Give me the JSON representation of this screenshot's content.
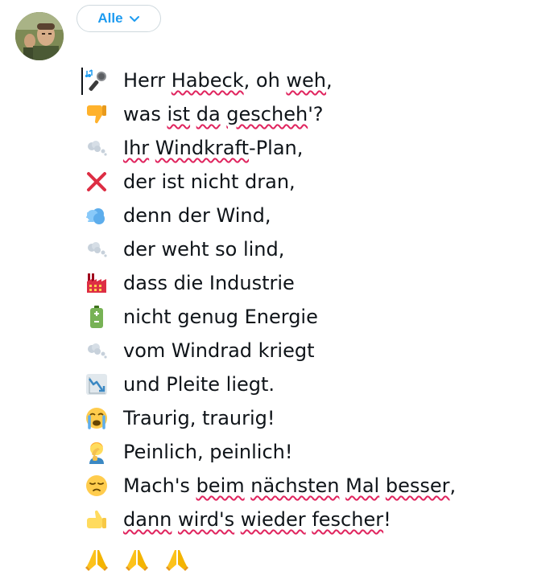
{
  "header": {
    "audience_label": "Alle"
  },
  "poem": {
    "lines": [
      {
        "icon": "microphone-icon",
        "segments": [
          {
            "t": "Herr "
          },
          {
            "t": "Habeck",
            "sp": true
          },
          {
            "t": ", oh "
          },
          {
            "t": "weh",
            "sp": true
          },
          {
            "t": ","
          }
        ]
      },
      {
        "icon": "thumbs-down-icon",
        "segments": [
          {
            "t": "was "
          },
          {
            "t": "ist",
            "sp": true
          },
          {
            "t": " "
          },
          {
            "t": "da",
            "sp": true
          },
          {
            "t": " "
          },
          {
            "t": "gescheh",
            "sp": true
          },
          {
            "t": "'?"
          }
        ]
      },
      {
        "icon": "dashing-away-icon",
        "segments": [
          {
            "t": "Ihr",
            "sp": true
          },
          {
            "t": " "
          },
          {
            "t": "Windkraft",
            "sp": true
          },
          {
            "t": "-Plan,"
          }
        ]
      },
      {
        "icon": "cross-mark-icon",
        "segments": [
          {
            "t": "der ist nicht dran,"
          }
        ]
      },
      {
        "icon": "wind-face-icon",
        "segments": [
          {
            "t": "denn der Wind,"
          }
        ]
      },
      {
        "icon": "dashing-away-icon",
        "segments": [
          {
            "t": "der weht so lind,"
          }
        ]
      },
      {
        "icon": "factory-icon",
        "segments": [
          {
            "t": "dass die Industrie"
          }
        ]
      },
      {
        "icon": "battery-icon",
        "segments": [
          {
            "t": "nicht genug Energie"
          }
        ]
      },
      {
        "icon": "dashing-away-icon",
        "segments": [
          {
            "t": "vom Windrad kriegt"
          }
        ]
      },
      {
        "icon": "chart-decreasing-icon",
        "segments": [
          {
            "t": "und Pleite liegt."
          }
        ]
      },
      {
        "icon": "crying-face-icon",
        "segments": [
          {
            "t": "Traurig, traurig!"
          }
        ]
      },
      {
        "icon": "facepalm-icon",
        "segments": [
          {
            "t": "Peinlich, peinlich!"
          }
        ]
      },
      {
        "icon": "pensive-face-icon",
        "segments": [
          {
            "t": "Mach's "
          },
          {
            "t": "beim",
            "sp": true
          },
          {
            "t": " "
          },
          {
            "t": "nächsten",
            "sp": true
          },
          {
            "t": " "
          },
          {
            "t": "Mal",
            "sp": true
          },
          {
            "t": " "
          },
          {
            "t": "besser",
            "sp": true
          },
          {
            "t": ","
          }
        ]
      },
      {
        "icon": "thumbs-up-icon",
        "segments": [
          {
            "t": "dann",
            "sp": true
          },
          {
            "t": " "
          },
          {
            "t": "wird's",
            "sp": true
          },
          {
            "t": " "
          },
          {
            "t": "wieder",
            "sp": true
          },
          {
            "t": " "
          },
          {
            "t": "fescher",
            "sp": true
          },
          {
            "t": "!"
          }
        ]
      }
    ],
    "trailing_icons": [
      "folded-hands-icon",
      "folded-hands-icon",
      "folded-hands-icon"
    ]
  },
  "colors": {
    "accent": "#1d9bf0",
    "spellcheck": "#e0245e",
    "text": "#0f1419",
    "border": "#cfd9de"
  }
}
